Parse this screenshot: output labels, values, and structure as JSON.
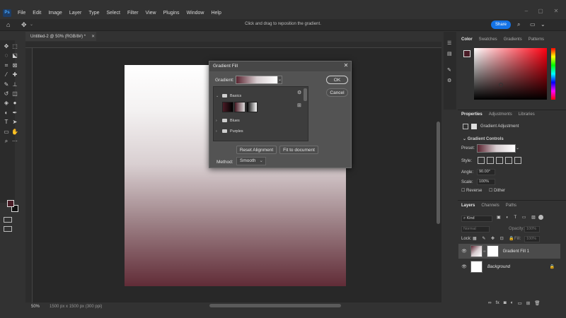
{
  "menubar": {
    "logo": "Ps",
    "items": [
      "File",
      "Edit",
      "Image",
      "Layer",
      "Type",
      "Select",
      "Filter",
      "View",
      "Plugins",
      "Window",
      "Help"
    ]
  },
  "options_bar": {
    "hint": "Click and drag to reposition the gradient.",
    "share_label": "Share"
  },
  "document": {
    "tab_title": "Untitled-2 @ 50% (RGB/8#) *",
    "zoom": "50%",
    "doc_info": "1500 px x 1500 px (300 ppi)",
    "gradient_colors": {
      "top": "#ffffff",
      "bottom": "#612c37"
    }
  },
  "tools": {
    "foreground_color": "#4a1c26",
    "background_color": "#111111"
  },
  "dialog": {
    "title": "Gradient Fill",
    "gradient_label": "Gradient:",
    "ok_label": "OK",
    "cancel_label": "Cancel",
    "folders": [
      {
        "name": "Basics",
        "expanded": true
      },
      {
        "name": "Blues",
        "expanded": false
      },
      {
        "name": "Purples",
        "expanded": false
      }
    ],
    "reset_alignment_label": "Reset Alignment",
    "fit_to_document_label": "Fit to document",
    "method_label": "Method:",
    "method_value": "Smooth"
  },
  "color_panel": {
    "tabs": [
      "Color",
      "Swatches",
      "Gradients",
      "Patterns"
    ],
    "active_tab": "Color",
    "hue_color": "#ff0011"
  },
  "properties_panel": {
    "tabs": [
      "Properties",
      "Adjustments",
      "Libraries"
    ],
    "subtitle": "Gradient Adjustment",
    "section": "Gradient Controls",
    "preset_label": "Preset:",
    "style_label": "Style:",
    "angle_label": "Angle:",
    "angle_value": "90.00°",
    "scale_label": "Scale:",
    "scale_value": "100%",
    "reverse_label": "Reverse",
    "dither_label": "Dither"
  },
  "layers_panel": {
    "tabs": [
      "Layers",
      "Channels",
      "Paths"
    ],
    "search_placeholder": "Kind",
    "blend_mode": "Normal",
    "opacity_label": "Opacity:",
    "opacity_value": "100%",
    "lock_label": "Lock:",
    "fill_label": "Fill:",
    "fill_value": "100%",
    "layers": [
      {
        "name": "Gradient Fill 1"
      },
      {
        "name": "Background"
      }
    ],
    "footer_fx": "fx"
  }
}
